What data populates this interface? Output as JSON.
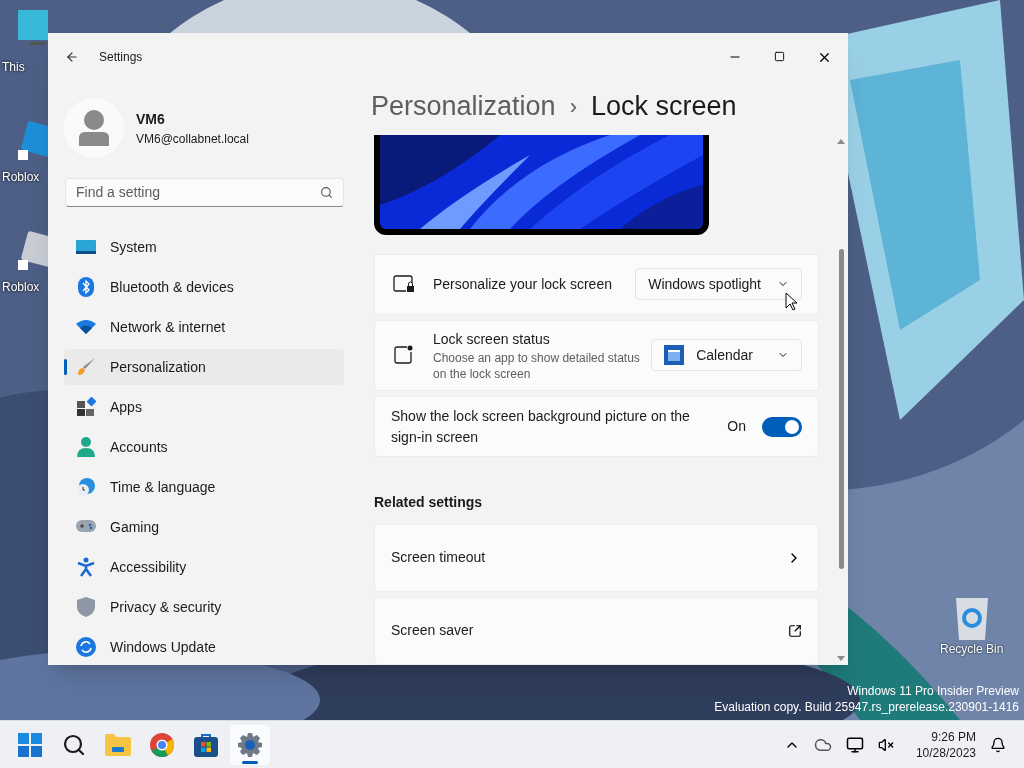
{
  "desktop": {
    "icons": [
      {
        "label": "This"
      },
      {
        "label": "Roblox"
      },
      {
        "label": "Roblox"
      }
    ],
    "recycle_bin": {
      "label": "Recycle Bin"
    },
    "watermark": [
      "Windows 11 Pro Insider Preview",
      "Evaluation copy. Build 25947.rs_prerelease.230901-1416"
    ]
  },
  "window": {
    "title": "Settings",
    "profile": {
      "name": "VM6",
      "email": "VM6@collabnet.local"
    },
    "search": {
      "placeholder": "Find a setting"
    },
    "nav": [
      {
        "label": "System",
        "selected": false
      },
      {
        "label": "Bluetooth & devices",
        "selected": false
      },
      {
        "label": "Network & internet",
        "selected": false
      },
      {
        "label": "Personalization",
        "selected": true
      },
      {
        "label": "Apps",
        "selected": false
      },
      {
        "label": "Accounts",
        "selected": false
      },
      {
        "label": "Time & language",
        "selected": false
      },
      {
        "label": "Gaming",
        "selected": false
      },
      {
        "label": "Accessibility",
        "selected": false
      },
      {
        "label": "Privacy & security",
        "selected": false
      },
      {
        "label": "Windows Update",
        "selected": false
      }
    ],
    "breadcrumb": {
      "parent": "Personalization",
      "separator": "›",
      "current": "Lock screen"
    },
    "settings": [
      {
        "kind": "dropdown",
        "title": "Personalize your lock screen",
        "value": "Windows spotlight"
      },
      {
        "kind": "app-dropdown",
        "title": "Lock screen status",
        "description": "Choose an app to show detailed status on the lock screen",
        "value": "Calendar"
      },
      {
        "kind": "toggle",
        "title": "Show the lock screen background picture on the sign-in screen",
        "state_label": "On",
        "on": true
      }
    ],
    "related": {
      "heading": "Related settings",
      "items": [
        {
          "kind": "link",
          "title": "Screen timeout"
        },
        {
          "kind": "external",
          "title": "Screen saver"
        }
      ]
    }
  },
  "taskbar": {
    "apps": [
      {
        "selected": false
      },
      {
        "selected": false
      },
      {
        "selected": false
      },
      {
        "selected": false
      },
      {
        "selected": false
      },
      {
        "selected": true
      }
    ],
    "time": "9:26 PM",
    "date": "10/28/2023"
  }
}
